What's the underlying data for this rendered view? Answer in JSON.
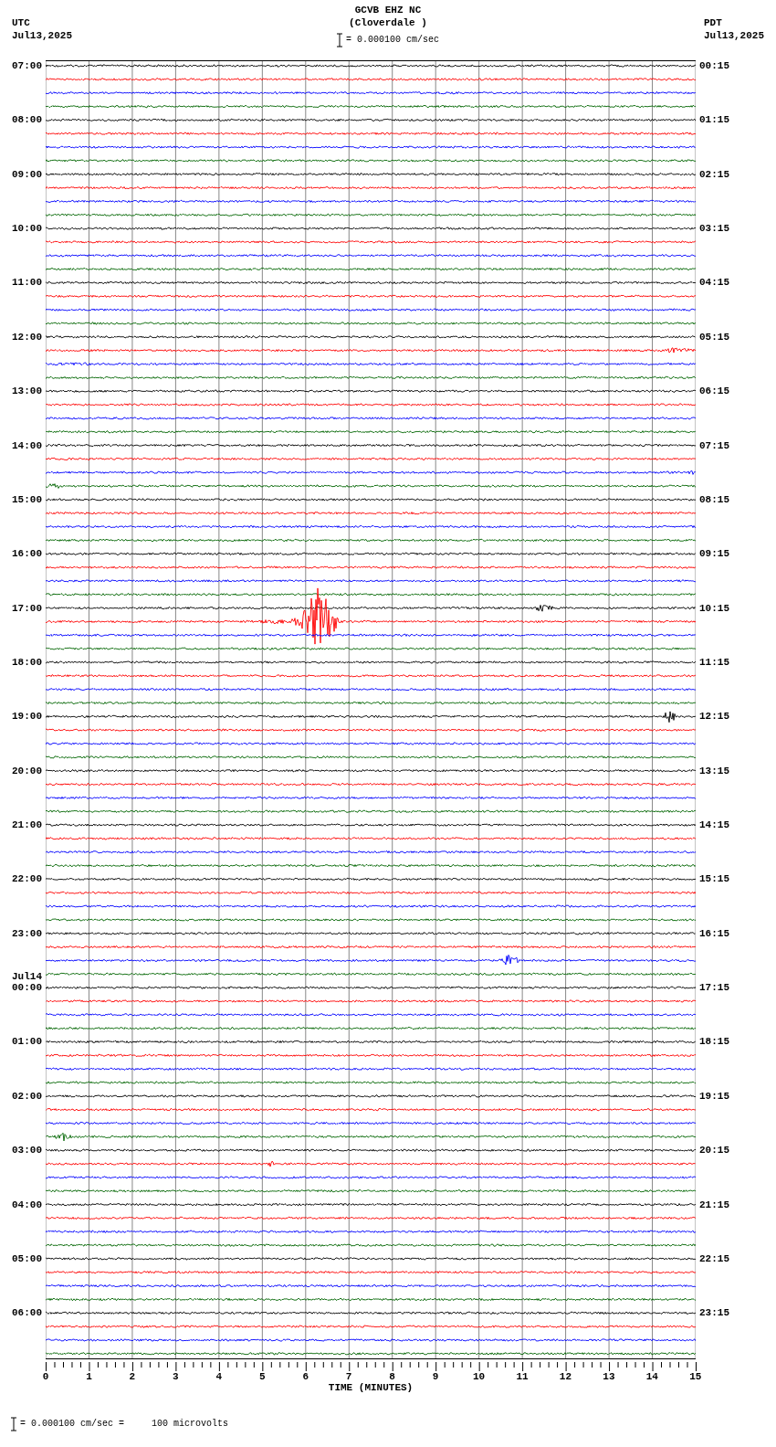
{
  "header": {
    "left_zone": "UTC",
    "left_date": "Jul13,2025",
    "station": "GCVB EHZ NC",
    "location": "(Cloverdale )",
    "scale": "= 0.000100 cm/sec",
    "right_zone": "PDT",
    "right_date": "Jul13,2025"
  },
  "left_labels": [
    {
      "time": "07:00"
    },
    {
      "time": "08:00"
    },
    {
      "time": "09:00"
    },
    {
      "time": "10:00"
    },
    {
      "time": "11:00"
    },
    {
      "time": "12:00"
    },
    {
      "time": "13:00"
    },
    {
      "time": "14:00"
    },
    {
      "time": "15:00"
    },
    {
      "time": "16:00"
    },
    {
      "time": "17:00"
    },
    {
      "time": "18:00"
    },
    {
      "time": "19:00"
    },
    {
      "time": "20:00"
    },
    {
      "time": "21:00"
    },
    {
      "time": "22:00"
    },
    {
      "time": "23:00"
    },
    {
      "date": "Jul14",
      "time": "00:00"
    },
    {
      "time": "01:00"
    },
    {
      "time": "02:00"
    },
    {
      "time": "03:00"
    },
    {
      "time": "04:00"
    },
    {
      "time": "05:00"
    },
    {
      "time": "06:00"
    }
  ],
  "right_labels": [
    "00:15",
    "01:15",
    "02:15",
    "03:15",
    "04:15",
    "05:15",
    "06:15",
    "07:15",
    "08:15",
    "09:15",
    "10:15",
    "11:15",
    "12:15",
    "13:15",
    "14:15",
    "15:15",
    "16:15",
    "17:15",
    "18:15",
    "19:15",
    "20:15",
    "21:15",
    "22:15",
    "23:15"
  ],
  "x_ticks": [
    "0",
    "1",
    "2",
    "3",
    "4",
    "5",
    "6",
    "7",
    "8",
    "9",
    "10",
    "11",
    "12",
    "13",
    "14",
    "15"
  ],
  "x_axis_title": "TIME (MINUTES)",
  "footer": "= 0.000100 cm/sec =     100 microvolts"
}
